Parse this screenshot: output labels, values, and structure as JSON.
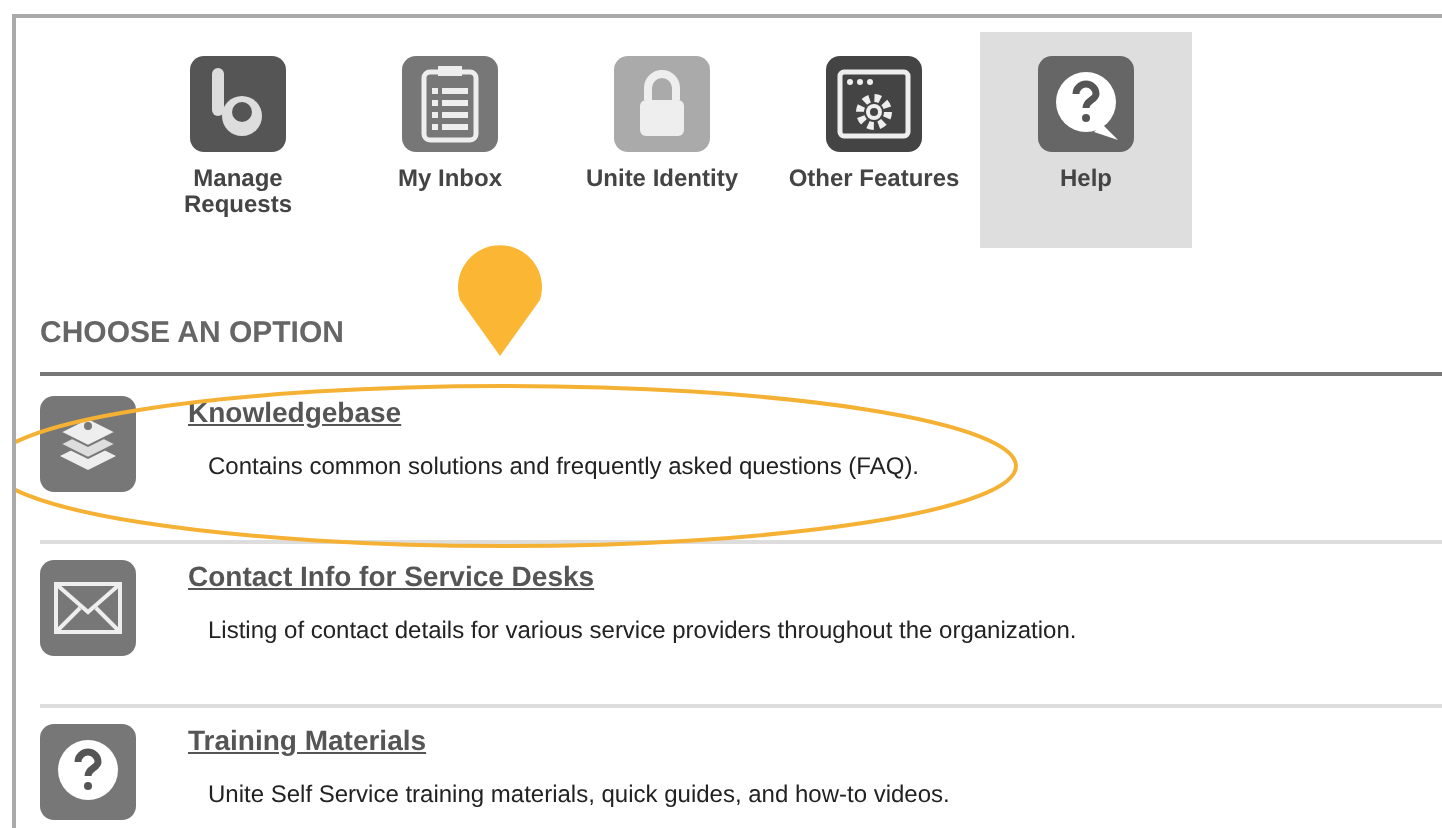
{
  "nav": [
    {
      "kind": "requests",
      "label": "Manage Requests",
      "selected": false
    },
    {
      "kind": "inbox",
      "label": "My Inbox",
      "selected": false
    },
    {
      "kind": "identity",
      "label": "Unite Identity",
      "selected": false
    },
    {
      "kind": "features",
      "label": "Other Features",
      "selected": false
    },
    {
      "kind": "help",
      "label": "Help",
      "selected": true
    }
  ],
  "heading": "CHOOSE AN OPTION",
  "options": [
    {
      "kind": "books",
      "title": "Knowledgebase",
      "description": "Contains common solutions and frequently asked questions (FAQ)."
    },
    {
      "kind": "mail",
      "title": "Contact Info for Service Desks",
      "description": "Listing of contact details for various service providers throughout the organization."
    },
    {
      "kind": "question",
      "title": "Training Materials",
      "description": "Unite Self Service training materials, quick guides, and how-to videos."
    }
  ]
}
